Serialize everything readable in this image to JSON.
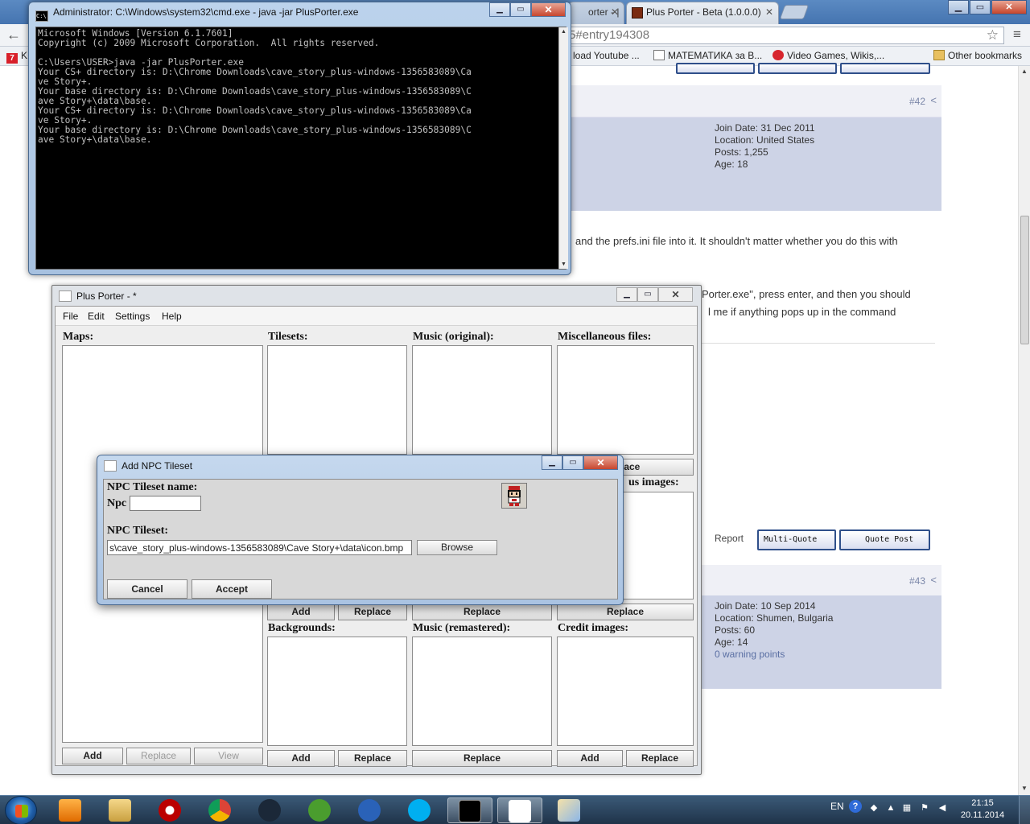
{
  "browser": {
    "tabs": [
      {
        "label": "orter - |"
      },
      {
        "label": "Plus Porter - Beta (1.0.0.0)"
      }
    ],
    "address": "5#entry194308",
    "bookmarks": [
      {
        "label": "K",
        "icon": "seven-icon"
      },
      {
        "label": "load Youtube ...",
        "icon": "document-icon"
      },
      {
        "label": "МАТЕМАТИКА за В...",
        "icon": "document-icon"
      },
      {
        "label": "Video Games, Wikis,...",
        "icon": "wikia-icon"
      },
      {
        "label": "Other bookmarks",
        "icon": "folder-icon"
      }
    ]
  },
  "forum": {
    "post42": {
      "number": "#42",
      "join": "Join Date: 31 Dec 2011",
      "location": "Location: United States",
      "posts": "Posts: 1,255",
      "age": "Age: 18"
    },
    "body_line1": "and the prefs.ini file into it. It shouldn't matter whether you do this with",
    "body_line2": "Porter.exe\", press enter, and then you should",
    "body_line3": "l me if anything pops up in the command",
    "report": "Report",
    "multi_quote": "Multi-Quote",
    "quote_post": "Quote Post",
    "post43": {
      "number": "#43",
      "join": "Join Date: 10 Sep 2014",
      "location": "Location: Shumen, Bulgaria",
      "posts": "Posts: 60",
      "age": "Age: 14",
      "warnings": "0 warning points"
    }
  },
  "cmd": {
    "title": "Administrator: C:\\Windows\\system32\\cmd.exe - java  -jar PlusPorter.exe",
    "lines": [
      "Microsoft Windows [Version 6.1.7601]",
      "Copyright (c) 2009 Microsoft Corporation.  All rights reserved.",
      "",
      "C:\\Users\\USER>java -jar PlusPorter.exe",
      "Your CS+ directory is: D:\\Chrome Downloads\\cave_story_plus-windows-1356583089\\Ca",
      "ve Story+.",
      "Your base directory is: D:\\Chrome Downloads\\cave_story_plus-windows-1356583089\\C",
      "ave Story+\\data\\base.",
      "Your CS+ directory is: D:\\Chrome Downloads\\cave_story_plus-windows-1356583089\\Ca",
      "ve Story+.",
      "Your base directory is: D:\\Chrome Downloads\\cave_story_plus-windows-1356583089\\C",
      "ave Story+\\data\\base."
    ]
  },
  "plusporter": {
    "title": "Plus Porter - *",
    "menu": [
      "File",
      "Edit",
      "Settings",
      "Help"
    ],
    "sections": {
      "maps": "Maps:",
      "tilesets": "Tilesets:",
      "music_original": "Music (original):",
      "misc": "Miscellaneous files:",
      "misc_images": "us images:",
      "backgrounds": "Backgrounds:",
      "music_remastered": "Music (remastered):",
      "credit_images": "Credit images:"
    },
    "buttons": {
      "add": "Add",
      "replace": "Replace",
      "view": "View",
      "partial_replace": "lace"
    }
  },
  "dialog": {
    "title": "Add NPC Tileset",
    "name_label": "NPC Tileset name:",
    "prefix": "Npc",
    "name_value": "",
    "tileset_label": "NPC Tileset:",
    "path_value": "s\\cave_story_plus-windows-1356583089\\Cave Story+\\data\\icon.bmp",
    "browse": "Browse",
    "cancel": "Cancel",
    "accept": "Accept"
  },
  "taskbar": {
    "lang": "EN",
    "time": "21:15",
    "date": "20.11.2014 г."
  }
}
